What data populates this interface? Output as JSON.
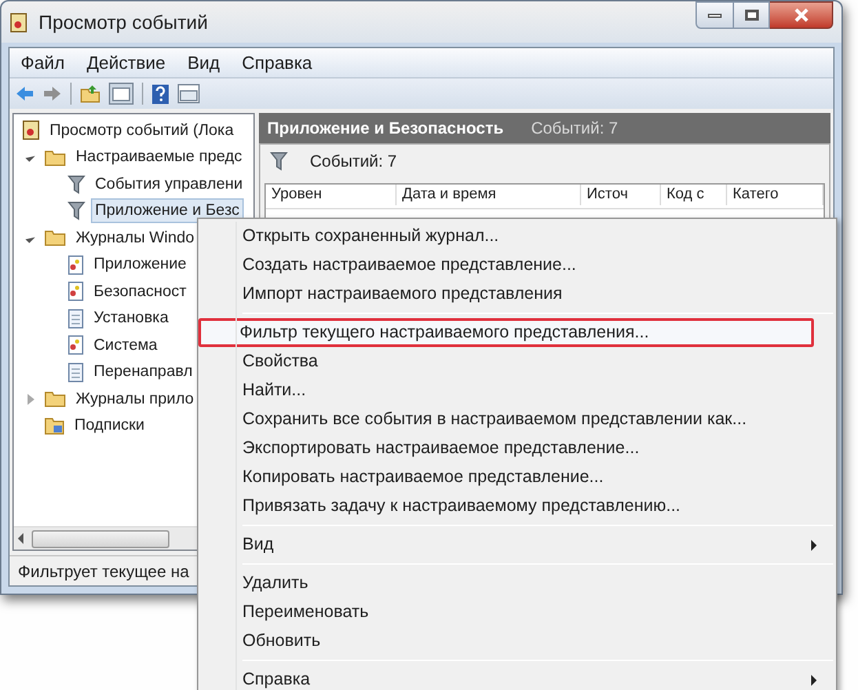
{
  "window": {
    "title": "Просмотр событий"
  },
  "menubar": [
    "Файл",
    "Действие",
    "Вид",
    "Справка"
  ],
  "tree": [
    {
      "label": "Просмотр событий (Лока",
      "kind": "viewer",
      "selected": false,
      "children": [
        {
          "label": "Настраиваемые предс",
          "kind": "folder",
          "expanded": true,
          "selected": false,
          "children": [
            {
              "label": "События управлени",
              "kind": "filter",
              "selected": false
            },
            {
              "label": "Приложение и Безс",
              "kind": "filter",
              "selected": true
            }
          ]
        },
        {
          "label": "Журналы Windo",
          "kind": "folder",
          "expanded": true,
          "selected": false,
          "children": [
            {
              "label": "Приложение",
              "kind": "log",
              "selected": false
            },
            {
              "label": "Безопасност",
              "kind": "log",
              "selected": false
            },
            {
              "label": "Установка",
              "kind": "plainlog",
              "selected": false
            },
            {
              "label": "Система",
              "kind": "log",
              "selected": false
            },
            {
              "label": "Перенаправл",
              "kind": "plainlog",
              "selected": false
            }
          ]
        },
        {
          "label": "Журналы прило",
          "kind": "folder",
          "expanded": false,
          "selected": false
        },
        {
          "label": "Подписки",
          "kind": "subs",
          "selected": false
        }
      ]
    }
  ],
  "pane": {
    "title": "Приложение и Безопасность",
    "count": "Событий: 7",
    "filter_count": "Событий: 7",
    "columns": [
      "Уровен",
      "Дата и время",
      "Источ",
      "Код с",
      "Катего"
    ]
  },
  "status_bar": "Фильтрует текущее на",
  "context_menu": [
    [
      {
        "label": "Открыть сохраненный журнал...",
        "submenu": false,
        "selected": false
      },
      {
        "label": "Создать настраиваемое представление...",
        "submenu": false,
        "selected": false
      },
      {
        "label": "Импорт настраиваемого представления",
        "submenu": false,
        "selected": false
      }
    ],
    [
      {
        "label": "Фильтр текущего настраиваемого представления...",
        "submenu": false,
        "selected": true
      },
      {
        "label": "Свойства",
        "submenu": false,
        "selected": false
      },
      {
        "label": "Найти...",
        "submenu": false,
        "selected": false
      },
      {
        "label": "Сохранить все события в настраиваемом представлении как...",
        "submenu": false,
        "selected": false
      },
      {
        "label": "Экспортировать настраиваемое представление...",
        "submenu": false,
        "selected": false
      },
      {
        "label": "Копировать настраиваемое представление...",
        "submenu": false,
        "selected": false
      },
      {
        "label": "Привязать задачу к настраиваемому представлению...",
        "submenu": false,
        "selected": false
      }
    ],
    [
      {
        "label": "Вид",
        "submenu": true,
        "selected": false
      }
    ],
    [
      {
        "label": "Удалить",
        "submenu": false,
        "selected": false
      },
      {
        "label": "Переименовать",
        "submenu": false,
        "selected": false
      },
      {
        "label": "Обновить",
        "submenu": false,
        "selected": false
      }
    ],
    [
      {
        "label": "Справка",
        "submenu": true,
        "selected": false
      }
    ]
  ]
}
